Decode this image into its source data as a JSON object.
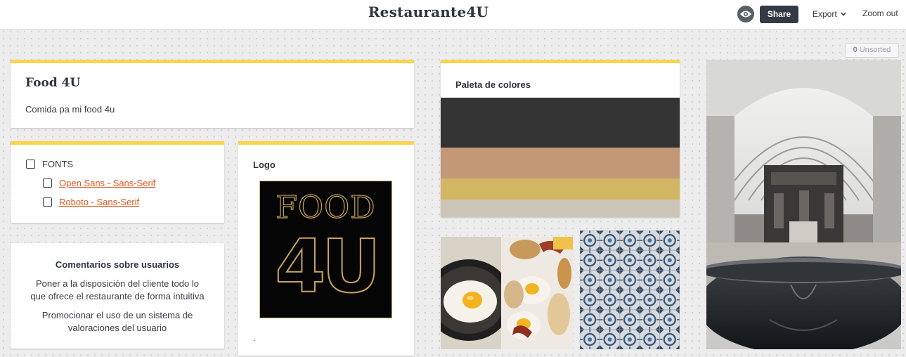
{
  "header": {
    "title": "Restaurante4U",
    "share_label": "Share",
    "export_label": "Export",
    "zoom_label": "Zoom out"
  },
  "unsorted": {
    "count": "0",
    "label": "Unsorted"
  },
  "note_card": {
    "title": "Food 4U",
    "body": "Comida pa mi food 4u"
  },
  "todo_card": {
    "items": [
      {
        "label": "FONTS",
        "checked": false
      },
      {
        "label": "Open Sans - Sans-Serif",
        "checked": false
      },
      {
        "label": "Roboto - Sans-Serif",
        "checked": false
      }
    ]
  },
  "comments_card": {
    "title": "Comentarios sobre usuarios",
    "paragraph1": "Poner a la disposición del cliente todo lo que ofrece el restaurante de forma intuitiva",
    "paragraph2": "Promocionar el uso de un sistema de valoraciones del usuario"
  },
  "logo_card": {
    "title": "Logo",
    "logo_line1": "FOOD",
    "logo_line2": "4U",
    "caption": "."
  },
  "palette_card": {
    "title": "Paleta de colores",
    "colors": [
      "#333333",
      "#c29876",
      "#d3b663",
      "#cdc5b7"
    ]
  },
  "images": [
    {
      "name": "breakfast-eggs-image",
      "icon": "food-photo"
    },
    {
      "name": "azulejo-tiles-image",
      "icon": "tile-pattern-photo"
    },
    {
      "name": "museum-hall-image",
      "icon": "architecture-photo"
    }
  ]
}
